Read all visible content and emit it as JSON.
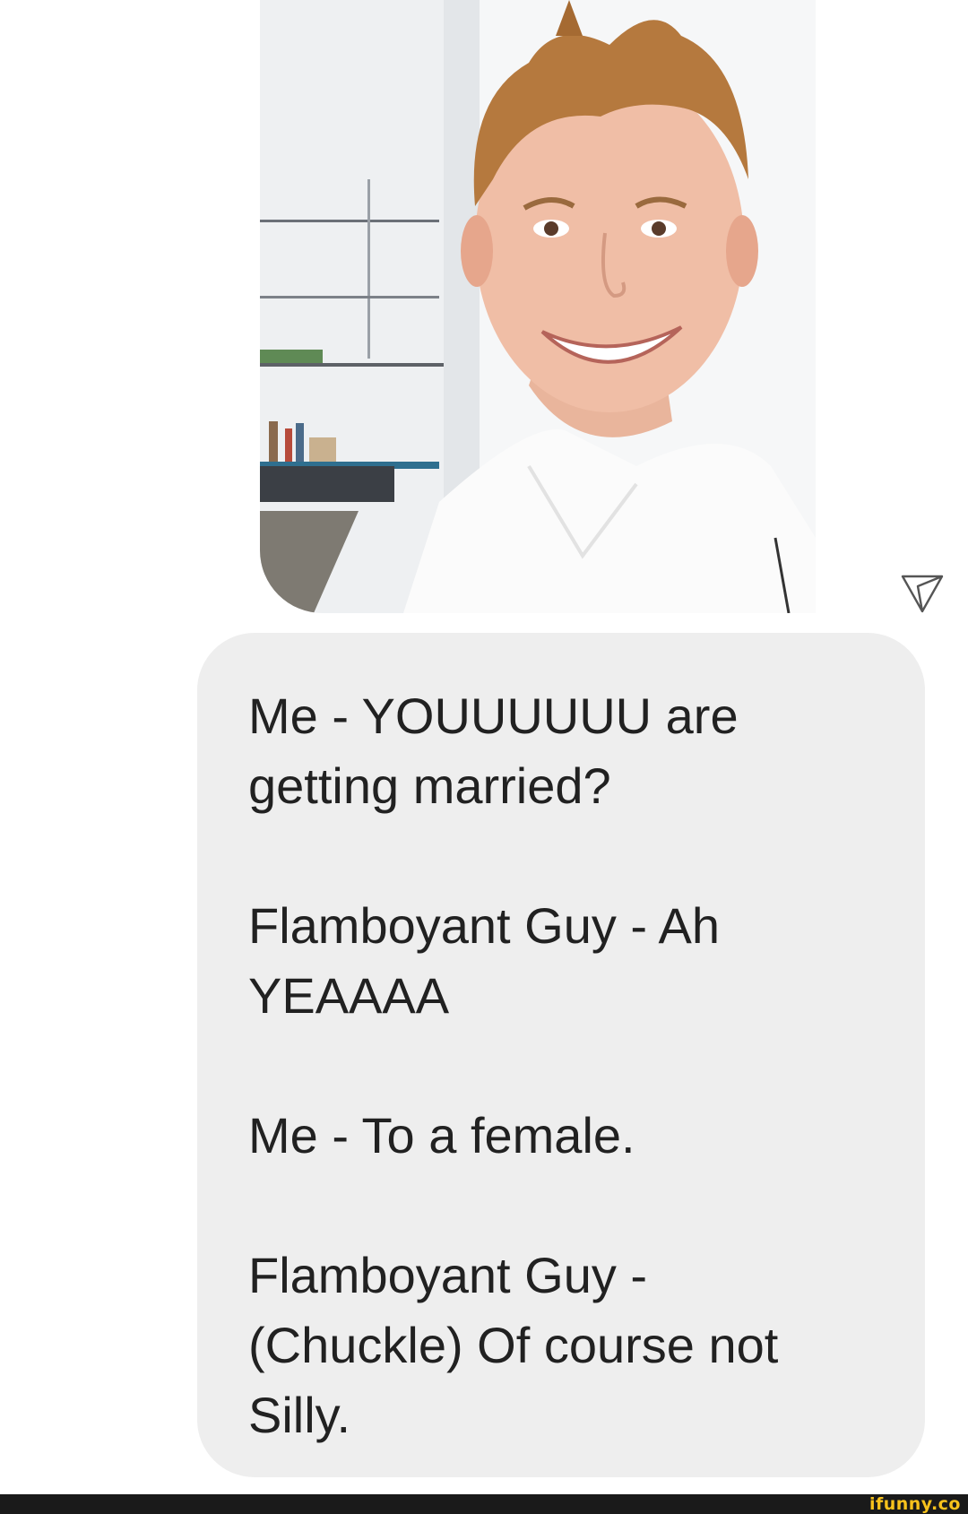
{
  "photo": {
    "subject": "smiling-man-photo"
  },
  "message": {
    "lines": [
      "Me - YOUUUUUU are",
      "getting married?",
      "",
      "Flamboyant Guy - Ah",
      "YEAAAA",
      "",
      "Me - To a female.",
      "",
      "Flamboyant Guy -",
      "(Chuckle) Of course not",
      "Silly."
    ]
  },
  "watermark": {
    "text": "ifunny.co"
  },
  "colors": {
    "bubble": "#eeeeee",
    "text": "#212121",
    "bottom_bar": "#1a1a1a",
    "watermark": "#f7c21c"
  }
}
